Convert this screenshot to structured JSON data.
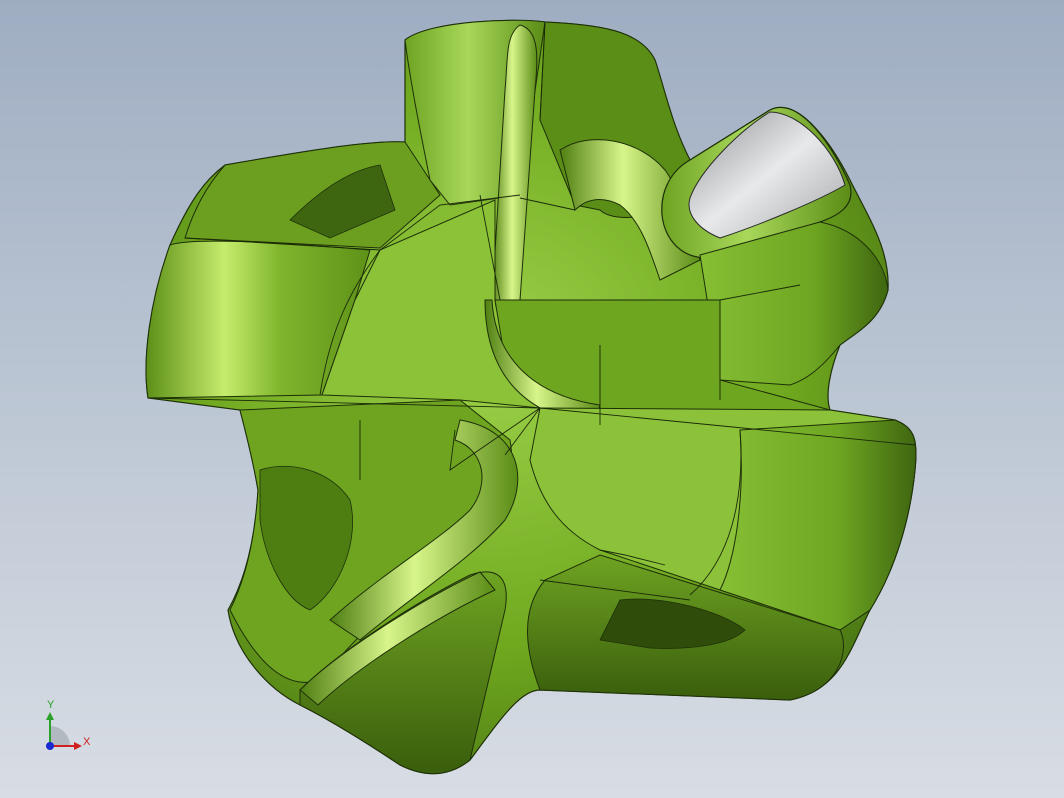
{
  "viewport": {
    "background_top": "#9fadc2",
    "background_bottom": "#d8dde4"
  },
  "model": {
    "body_color": "#6fa81e",
    "highlight_color": "#c8ef6a",
    "shadow_color": "#3a5e0c",
    "edge_color": "#1a2a08",
    "end_face_color": "#c7c9cc"
  },
  "triad": {
    "x_label": "X",
    "y_label": "Y",
    "x_color": "#d02020",
    "y_color": "#2aa02a",
    "z_color": "#1a2ad0"
  }
}
